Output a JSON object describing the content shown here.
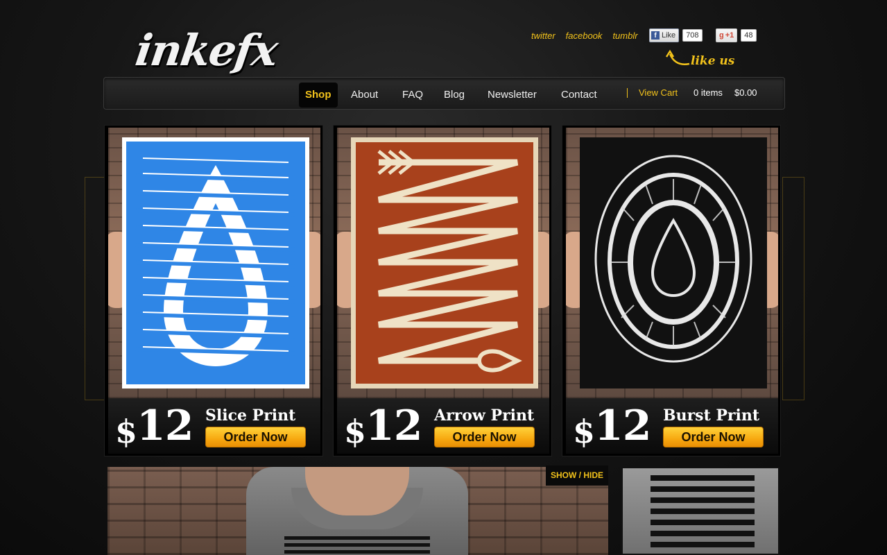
{
  "brand": {
    "logo_text": "inkefx"
  },
  "social": {
    "links": [
      "twitter",
      "facebook",
      "tumblr"
    ],
    "facebook_like": {
      "label": "Like",
      "count": "708"
    },
    "google_plus": {
      "label": "+1",
      "count": "48"
    },
    "like_us": "like us"
  },
  "nav": {
    "items": [
      {
        "label": "Shop",
        "active": true
      },
      {
        "label": "About"
      },
      {
        "label": "FAQ"
      },
      {
        "label": "Blog"
      },
      {
        "label": "Newsletter"
      },
      {
        "label": "Contact"
      }
    ],
    "cart": {
      "label": "View Cart",
      "items": "0 items",
      "total": "$0.00"
    }
  },
  "products": [
    {
      "currency": "$",
      "price": "12",
      "name": "Slice Print",
      "cta": "Order Now",
      "poster_color": "#2f86e6"
    },
    {
      "currency": "$",
      "price": "12",
      "name": "Arrow Print",
      "cta": "Order Now",
      "poster_color": "#a8411c"
    },
    {
      "currency": "$",
      "price": "12",
      "name": "Burst Print",
      "cta": "Order Now",
      "poster_color": "#111111"
    }
  ],
  "featured": {
    "toggle_label": "SHOW / HIDE"
  },
  "colors": {
    "accent": "#f2c21b",
    "button": "#f7a810"
  }
}
